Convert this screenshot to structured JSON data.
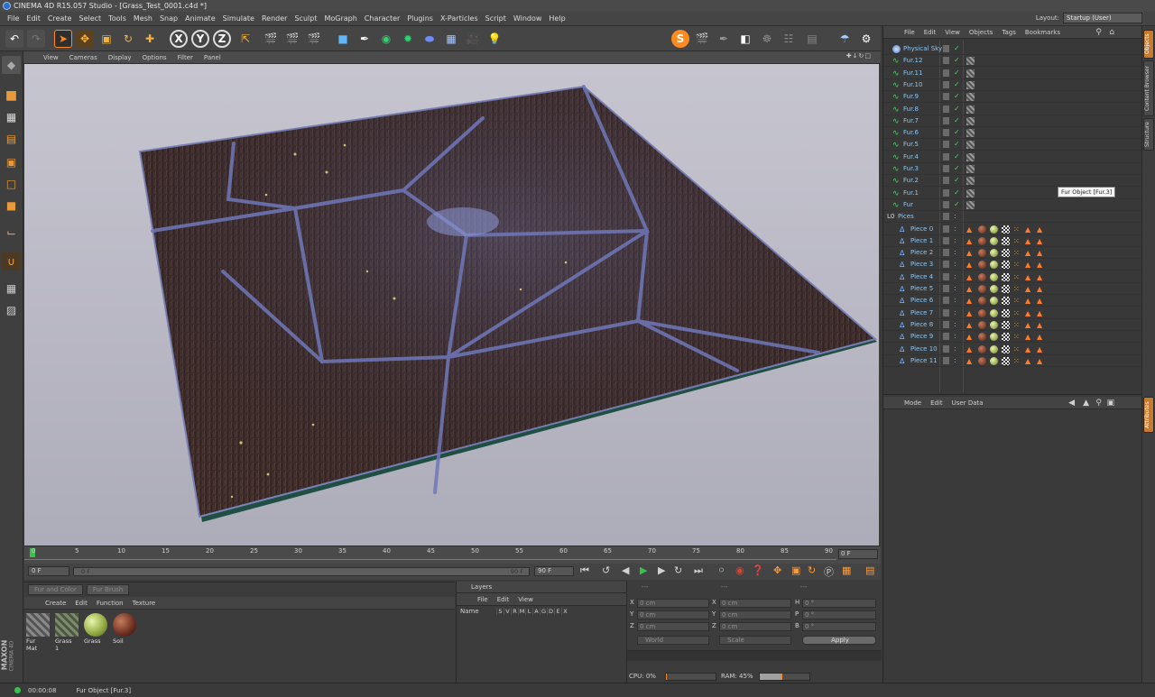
{
  "window": {
    "title": "CINEMA 4D R15.057 Studio - [Grass_Test_0001.c4d *]"
  },
  "menu": [
    "File",
    "Edit",
    "Create",
    "Select",
    "Tools",
    "Mesh",
    "Snap",
    "Animate",
    "Simulate",
    "Render",
    "Sculpt",
    "MoGraph",
    "Character",
    "Plugins",
    "X-Particles",
    "Script",
    "Window",
    "Help"
  ],
  "layout": {
    "label": "Layout:",
    "value": "Startup (User)"
  },
  "toolbar": {
    "axis_x": "X",
    "axis_y": "Y",
    "axis_z": "Z"
  },
  "viewport": {
    "menu": [
      "View",
      "Cameras",
      "Display",
      "Options",
      "Filter",
      "Panel"
    ],
    "nav": "✚↓↻□"
  },
  "timeline": {
    "ticks": [
      "0",
      "5",
      "10",
      "15",
      "20",
      "25",
      "30",
      "35",
      "40",
      "45",
      "50",
      "55",
      "60",
      "65",
      "70",
      "75",
      "80",
      "85",
      "90"
    ],
    "current_frame": "0 F",
    "start_frame": "0 F",
    "range_start": "0 F",
    "range_end": "90 F",
    "end_frame": "90 F"
  },
  "material_panel": {
    "tabs": [
      "Fur and Color",
      "Fur Brush"
    ],
    "menu": [
      "Create",
      "Edit",
      "Function",
      "Texture"
    ],
    "materials": [
      {
        "name": "Fur Mat",
        "type": "fur"
      },
      {
        "name": "Grass 1",
        "type": "grass"
      },
      {
        "name": "Grass",
        "type": "sphere-green"
      },
      {
        "name": "Soil",
        "type": "sphere-brown"
      }
    ]
  },
  "layers": {
    "title": "Layers",
    "menu": [
      "File",
      "Edit",
      "View"
    ],
    "name_col": "Name",
    "flags": [
      "S",
      "V",
      "R",
      "M",
      "L",
      "A",
      "G",
      "D",
      "E",
      "X"
    ]
  },
  "coordinates": {
    "headers": [
      "---",
      "---",
      "---"
    ],
    "rows": [
      {
        "l1": "X",
        "v1": "0 cm",
        "l2": "X",
        "v2": "0 cm",
        "l3": "H",
        "v3": "0 °"
      },
      {
        "l1": "Y",
        "v1": "0 cm",
        "l2": "Y",
        "v2": "0 cm",
        "l3": "P",
        "v3": "0 °"
      },
      {
        "l1": "Z",
        "v1": "0 cm",
        "l2": "Z",
        "v2": "0 cm",
        "l3": "B",
        "v3": "0 °"
      }
    ],
    "space": "World",
    "mode": "Scale",
    "apply": "Apply",
    "cpu_label": "CPU: 0%",
    "ram_label": "RAM: 45%",
    "ram_fraction": 0.45
  },
  "object_manager": {
    "menu": [
      "File",
      "Edit",
      "View",
      "Objects",
      "Tags",
      "Bookmarks"
    ],
    "objects": [
      {
        "name": "Physical Sky",
        "kind": "sky"
      },
      {
        "name": "Fur.12",
        "kind": "fur"
      },
      {
        "name": "Fur.11",
        "kind": "fur"
      },
      {
        "name": "Fur.10",
        "kind": "fur"
      },
      {
        "name": "Fur.9",
        "kind": "fur"
      },
      {
        "name": "Fur.8",
        "kind": "fur"
      },
      {
        "name": "Fur.7",
        "kind": "fur"
      },
      {
        "name": "Fur.6",
        "kind": "fur"
      },
      {
        "name": "Fur.5",
        "kind": "fur"
      },
      {
        "name": "Fur.4",
        "kind": "fur"
      },
      {
        "name": "Fur.3",
        "kind": "fur"
      },
      {
        "name": "Fur.2",
        "kind": "fur"
      },
      {
        "name": "Fur.1",
        "kind": "fur"
      },
      {
        "name": "Fur",
        "kind": "fur"
      },
      {
        "name": "Pices",
        "kind": "group"
      },
      {
        "name": "Piece 0",
        "kind": "piece"
      },
      {
        "name": "Piece 1",
        "kind": "piece"
      },
      {
        "name": "Piece 2",
        "kind": "piece"
      },
      {
        "name": "Piece 3",
        "kind": "piece"
      },
      {
        "name": "Piece 4",
        "kind": "piece"
      },
      {
        "name": "Piece 5",
        "kind": "piece"
      },
      {
        "name": "Piece 6",
        "kind": "piece"
      },
      {
        "name": "Piece 7",
        "kind": "piece"
      },
      {
        "name": "Piece 8",
        "kind": "piece"
      },
      {
        "name": "Piece 9",
        "kind": "piece"
      },
      {
        "name": "Piece 10",
        "kind": "piece"
      },
      {
        "name": "Piece 11",
        "kind": "piece"
      }
    ],
    "tooltip": "Fur Object [Fur.3]"
  },
  "attributes": {
    "menu": [
      "Mode",
      "Edit",
      "User Data"
    ]
  },
  "right_tabs": [
    "Objects",
    "Content Browser",
    "Structure"
  ],
  "right_tabs2": [
    "Attributes"
  ],
  "status": {
    "time": "00:00:08",
    "message": "Fur Object [Fur.3]"
  },
  "brand": {
    "line1": "MAXON",
    "line2": "CINEMA 4D"
  },
  "colors": {
    "accent": "#ff8a1f",
    "object_name": "#8ec6f0",
    "panel": "#3b3b3b"
  }
}
